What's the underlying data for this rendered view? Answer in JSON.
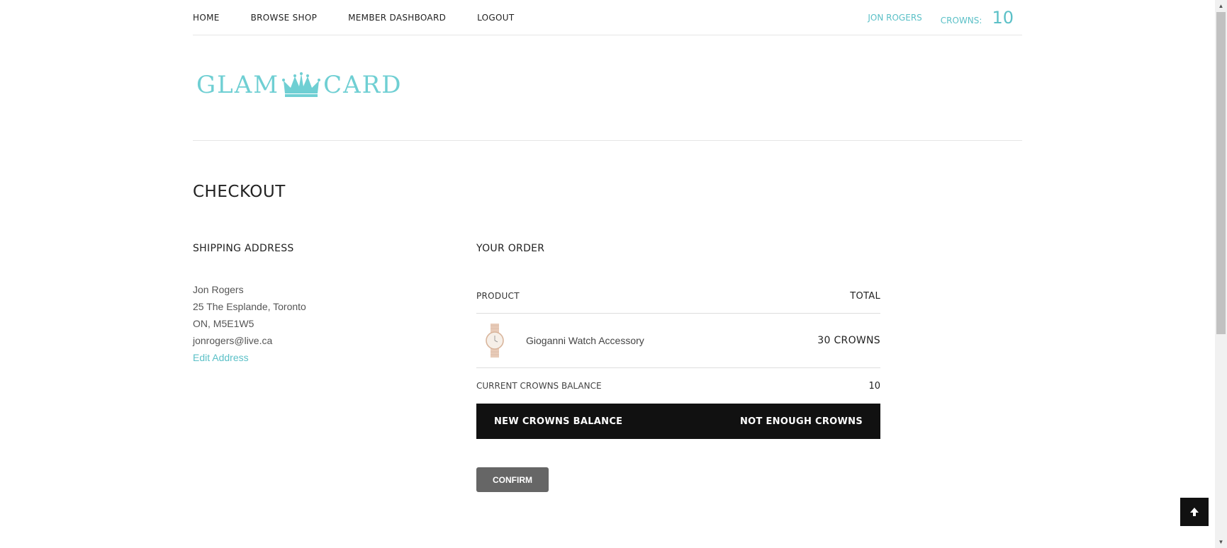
{
  "nav": {
    "items": [
      "HOME",
      "BROWSE SHOP",
      "MEMBER DASHBOARD",
      "LOGOUT"
    ],
    "user": "JON ROGERS",
    "crowns_label": "CROWNS:",
    "crowns_value": "10"
  },
  "logo": {
    "left": "GLAM",
    "right": "CARD",
    "icon": "crown-icon"
  },
  "page": {
    "title": "CHECKOUT"
  },
  "shipping": {
    "heading": "SHIPPING ADDRESS",
    "name": "Jon Rogers",
    "line1": "25 The Esplande, Toronto",
    "line2": "ON, M5E1W5",
    "email": "jonrogers@live.ca",
    "edit_link": "Edit Address"
  },
  "order": {
    "heading": "YOUR ORDER",
    "col_product": "PRODUCT",
    "col_total": "TOTAL",
    "item": {
      "name": "Gioganni Watch Accessory",
      "total": "30 CROWNS",
      "icon": "watch-icon"
    },
    "balance_label": "CURRENT CROWNS BALANCE",
    "balance_value": "10",
    "new_balance_label": "NEW CROWNS BALANCE",
    "new_balance_value": "NOT ENOUGH CROWNS",
    "confirm_label": "CONFIRM"
  },
  "colors": {
    "accent": "#5bc0c7",
    "dark": "#111111",
    "button": "#666666"
  }
}
